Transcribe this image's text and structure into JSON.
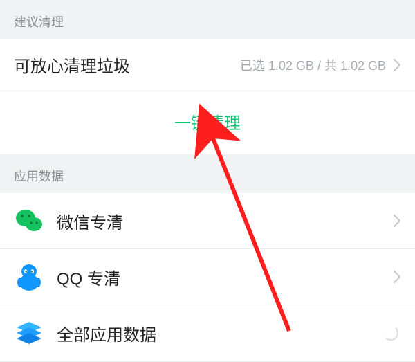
{
  "sections": {
    "suggest": {
      "header": "建议清理",
      "safe_clean": {
        "title": "可放心清理垃圾",
        "status": "已选 1.02 GB / 共 1.02 GB"
      },
      "action_label": "一键清理"
    },
    "appdata": {
      "header": "应用数据",
      "items": [
        {
          "label": "微信专清"
        },
        {
          "label": "QQ 专清"
        },
        {
          "label": "全部应用数据"
        }
      ]
    }
  }
}
